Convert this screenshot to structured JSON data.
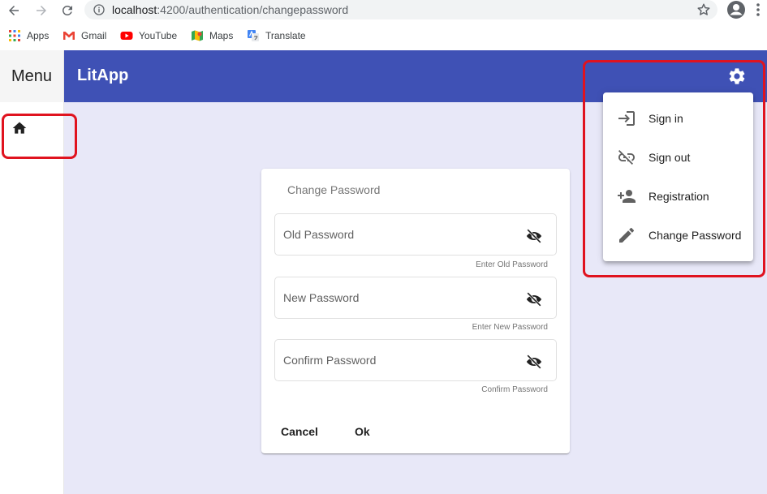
{
  "browser": {
    "url_host": "localhost",
    "url_rest": ":4200/authentication/changepassword",
    "bookmarks": [
      {
        "label": "Apps",
        "icon": "apps-grid-icon"
      },
      {
        "label": "Gmail",
        "icon": "gmail-icon"
      },
      {
        "label": "YouTube",
        "icon": "youtube-icon"
      },
      {
        "label": "Maps",
        "icon": "maps-icon"
      },
      {
        "label": "Translate",
        "icon": "translate-icon"
      }
    ]
  },
  "sidebar": {
    "title": "Menu",
    "home_icon": "home-icon"
  },
  "toolbar": {
    "title": "LitApp",
    "settings_icon": "gear-icon",
    "color": "#3f51b5"
  },
  "form": {
    "title": "Change Password",
    "fields": [
      {
        "placeholder": "Old Password",
        "hint": "Enter Old Password",
        "icon": "eye-off-icon"
      },
      {
        "placeholder": "New Password",
        "hint": "Enter New Password",
        "icon": "eye-off-icon"
      },
      {
        "placeholder": "Confirm Password",
        "hint": "Confirm Password",
        "icon": "eye-off-icon"
      }
    ],
    "cancel_label": "Cancel",
    "ok_label": "Ok"
  },
  "settings_menu": {
    "items": [
      {
        "label": "Sign in",
        "icon": "login-icon"
      },
      {
        "label": "Sign out",
        "icon": "link-off-icon"
      },
      {
        "label": "Registration",
        "icon": "person-add-icon"
      },
      {
        "label": "Change Password",
        "icon": "pencil-icon"
      }
    ]
  },
  "highlight_color": "#e0131f"
}
